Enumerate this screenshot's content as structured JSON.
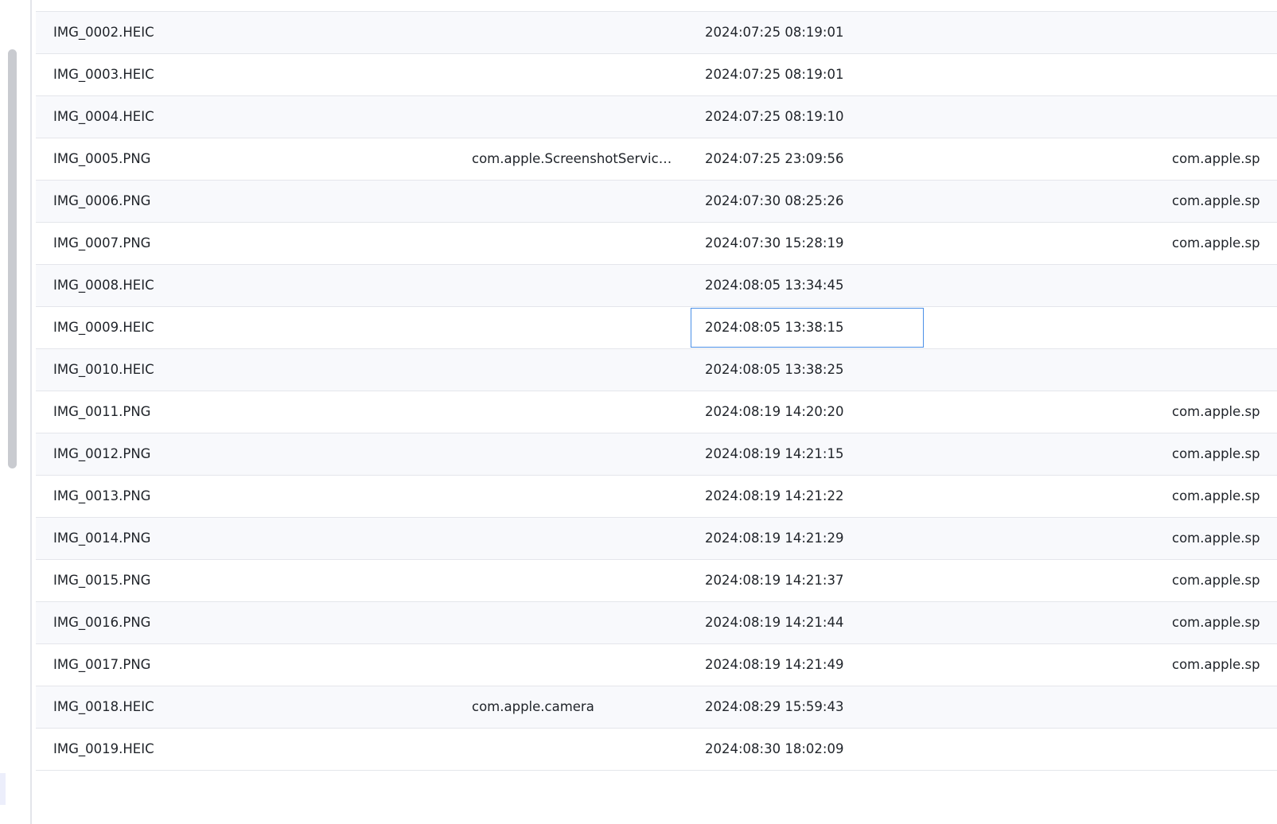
{
  "table": {
    "rows": [
      {
        "name": "IMG_0002.HEIC",
        "app": "",
        "date": "2024:07:25 08:19:01",
        "bundle": ""
      },
      {
        "name": "IMG_0003.HEIC",
        "app": "",
        "date": "2024:07:25 08:19:01",
        "bundle": ""
      },
      {
        "name": "IMG_0004.HEIC",
        "app": "",
        "date": "2024:07:25 08:19:10",
        "bundle": ""
      },
      {
        "name": "IMG_0005.PNG",
        "app": "com.apple.ScreenshotServicesS...",
        "date": "2024:07:25 23:09:56",
        "bundle": "com.apple.sp"
      },
      {
        "name": "IMG_0006.PNG",
        "app": "",
        "date": "2024:07:30 08:25:26",
        "bundle": "com.apple.sp"
      },
      {
        "name": "IMG_0007.PNG",
        "app": "",
        "date": "2024:07:30 15:28:19",
        "bundle": "com.apple.sp"
      },
      {
        "name": "IMG_0008.HEIC",
        "app": "",
        "date": "2024:08:05 13:34:45",
        "bundle": ""
      },
      {
        "name": "IMG_0009.HEIC",
        "app": "",
        "date": "2024:08:05 13:38:15",
        "bundle": ""
      },
      {
        "name": "IMG_0010.HEIC",
        "app": "",
        "date": "2024:08:05 13:38:25",
        "bundle": ""
      },
      {
        "name": "IMG_0011.PNG",
        "app": "",
        "date": "2024:08:19 14:20:20",
        "bundle": "com.apple.sp"
      },
      {
        "name": "IMG_0012.PNG",
        "app": "",
        "date": "2024:08:19 14:21:15",
        "bundle": "com.apple.sp"
      },
      {
        "name": "IMG_0013.PNG",
        "app": "",
        "date": "2024:08:19 14:21:22",
        "bundle": "com.apple.sp"
      },
      {
        "name": "IMG_0014.PNG",
        "app": "",
        "date": "2024:08:19 14:21:29",
        "bundle": "com.apple.sp"
      },
      {
        "name": "IMG_0015.PNG",
        "app": "",
        "date": "2024:08:19 14:21:37",
        "bundle": "com.apple.sp"
      },
      {
        "name": "IMG_0016.PNG",
        "app": "",
        "date": "2024:08:19 14:21:44",
        "bundle": "com.apple.sp"
      },
      {
        "name": "IMG_0017.PNG",
        "app": "",
        "date": "2024:08:19 14:21:49",
        "bundle": "com.apple.sp"
      },
      {
        "name": "IMG_0018.HEIC",
        "app": "com.apple.camera",
        "date": "2024:08:29 15:59:43",
        "bundle": ""
      },
      {
        "name": "IMG_0019.HEIC",
        "app": "",
        "date": "2024:08:30 18:02:09",
        "bundle": ""
      }
    ],
    "selected": {
      "row": 7,
      "column": "date"
    }
  },
  "colors": {
    "selection_border": "#4a8fe7",
    "row_alt": "#f8f9fc",
    "row_divider": "#e4e6eb",
    "text": "#1f2329",
    "scrollbar_thumb": "#c9cbd0"
  }
}
